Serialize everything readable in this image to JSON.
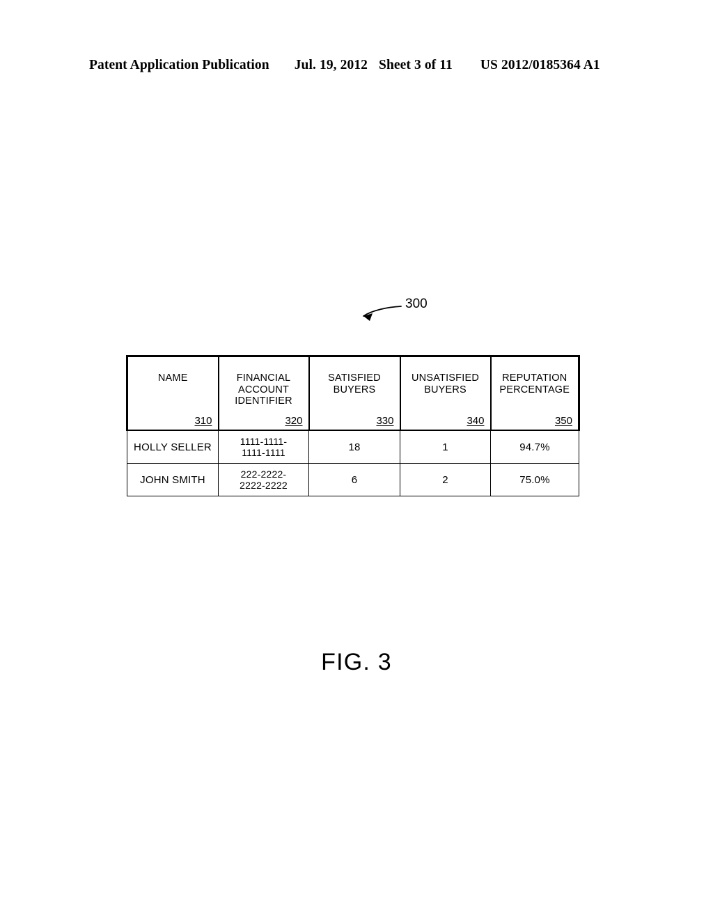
{
  "page_header": {
    "publication": "Patent Application Publication",
    "date": "Jul. 19, 2012",
    "sheet": "Sheet 3 of 11",
    "document_number": "US 2012/0185364 A1"
  },
  "callout": {
    "label": "300"
  },
  "figure": {
    "caption": "FIG. 3"
  },
  "table": {
    "columns": [
      {
        "title": "NAME",
        "ref": "310"
      },
      {
        "title": "FINANCIAL\nACCOUNT\nIDENTIFIER",
        "ref": "320"
      },
      {
        "title": "SATISFIED\nBUYERS",
        "ref": "330"
      },
      {
        "title": "UNSATISFIED\nBUYERS",
        "ref": "340"
      },
      {
        "title": "REPUTATION\nPERCENTAGE",
        "ref": "350"
      }
    ],
    "rows": [
      {
        "name": "HOLLY SELLER",
        "account_line1": "1111-1111-",
        "account_line2": "1111-1111",
        "satisfied_buyers": "18",
        "unsatisfied_buyers": "1",
        "reputation_percentage": "94.7%"
      },
      {
        "name": "JOHN SMITH",
        "account_line1": "222-2222-",
        "account_line2": "2222-2222",
        "satisfied_buyers": "6",
        "unsatisfied_buyers": "2",
        "reputation_percentage": "75.0%"
      }
    ]
  }
}
